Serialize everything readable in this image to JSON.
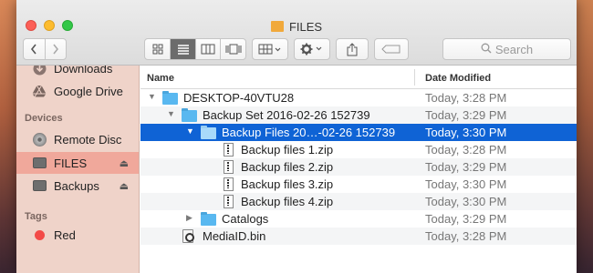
{
  "window": {
    "title": "FILES"
  },
  "toolbar": {
    "search_placeholder": "Search"
  },
  "sidebar": {
    "top_items": [
      {
        "label": "Downloads",
        "icon": "downloads-icon"
      },
      {
        "label": "Google Drive",
        "icon": "google-drive-icon"
      }
    ],
    "devices_header": "Devices",
    "devices": [
      {
        "label": "Remote Disc",
        "icon": "disc-icon",
        "eject": false
      },
      {
        "label": "FILES",
        "icon": "drive-icon",
        "eject": true,
        "selected": true
      },
      {
        "label": "Backups",
        "icon": "drive-icon",
        "eject": true
      }
    ],
    "tags_header": "Tags",
    "tags": [
      {
        "label": "Red",
        "color": "#f34a47"
      }
    ]
  },
  "columns": {
    "name": "Name",
    "date_modified": "Date Modified"
  },
  "rows": [
    {
      "name": "DESKTOP-40VTU28",
      "date": "Today, 3:28 PM",
      "type": "folder",
      "expanded": true
    },
    {
      "name": "Backup Set 2016-02-26 152739",
      "date": "Today, 3:29 PM",
      "type": "folder",
      "expanded": true
    },
    {
      "name": "Backup Files 20…-02-26 152739",
      "date": "Today, 3:30 PM",
      "type": "folder",
      "expanded": true,
      "selected": true
    },
    {
      "name": "Backup files 1.zip",
      "date": "Today, 3:28 PM",
      "type": "zip"
    },
    {
      "name": "Backup files 2.zip",
      "date": "Today, 3:29 PM",
      "type": "zip"
    },
    {
      "name": "Backup files 3.zip",
      "date": "Today, 3:30 PM",
      "type": "zip"
    },
    {
      "name": "Backup files 4.zip",
      "date": "Today, 3:30 PM",
      "type": "zip"
    },
    {
      "name": "Catalogs",
      "date": "Today, 3:29 PM",
      "type": "folder",
      "expanded": false
    },
    {
      "name": "MediaID.bin",
      "date": "Today, 3:28 PM",
      "type": "bin"
    }
  ],
  "colors": {
    "selection": "#0f63d5",
    "sidebar_selected": "#f0a89b",
    "folder": "#59b8f0"
  }
}
